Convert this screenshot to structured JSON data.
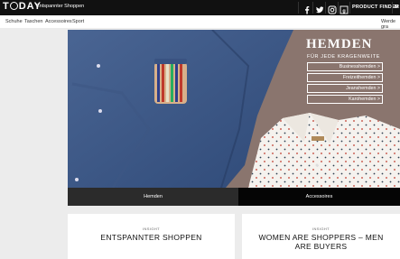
{
  "brand": {
    "logo_text": [
      "T",
      "DAY"
    ],
    "tagline": "Entspannter Shoppen"
  },
  "header": {
    "social_icons": [
      "facebook-icon",
      "twitter-icon",
      "instagram-icon",
      "google-plus-icon"
    ],
    "product_finder": "PRODUCT FINDER",
    "cut_label": "M"
  },
  "subnav": {
    "items": [
      "Schuhe",
      "Taschen",
      "Accessoires",
      "Sport"
    ],
    "right_text": "Werde gra"
  },
  "hero": {
    "title": "HEMDEN",
    "subtitle": "FÜR JEDE KRAGENWEITE",
    "buttons": [
      "Businesshemden >",
      "Freizeithemden >",
      "Jeanshemden >",
      "Karohemden >"
    ]
  },
  "tabs": [
    {
      "label": "Hemden",
      "active": true
    },
    {
      "label": "Accessoires",
      "active": false
    }
  ],
  "cards": [
    {
      "kicker": "INSIGHT",
      "title": "ENTSPANNTER SHOPPEN"
    },
    {
      "kicker": "INSIGHT",
      "title": "WOMEN ARE SHOPPERS – MEN ARE BUYERS"
    }
  ],
  "colors": {
    "topbar": "#111111",
    "tab_active": "#2b2b2b",
    "tab_inactive": "#050505",
    "page_bg": "#ececec"
  }
}
